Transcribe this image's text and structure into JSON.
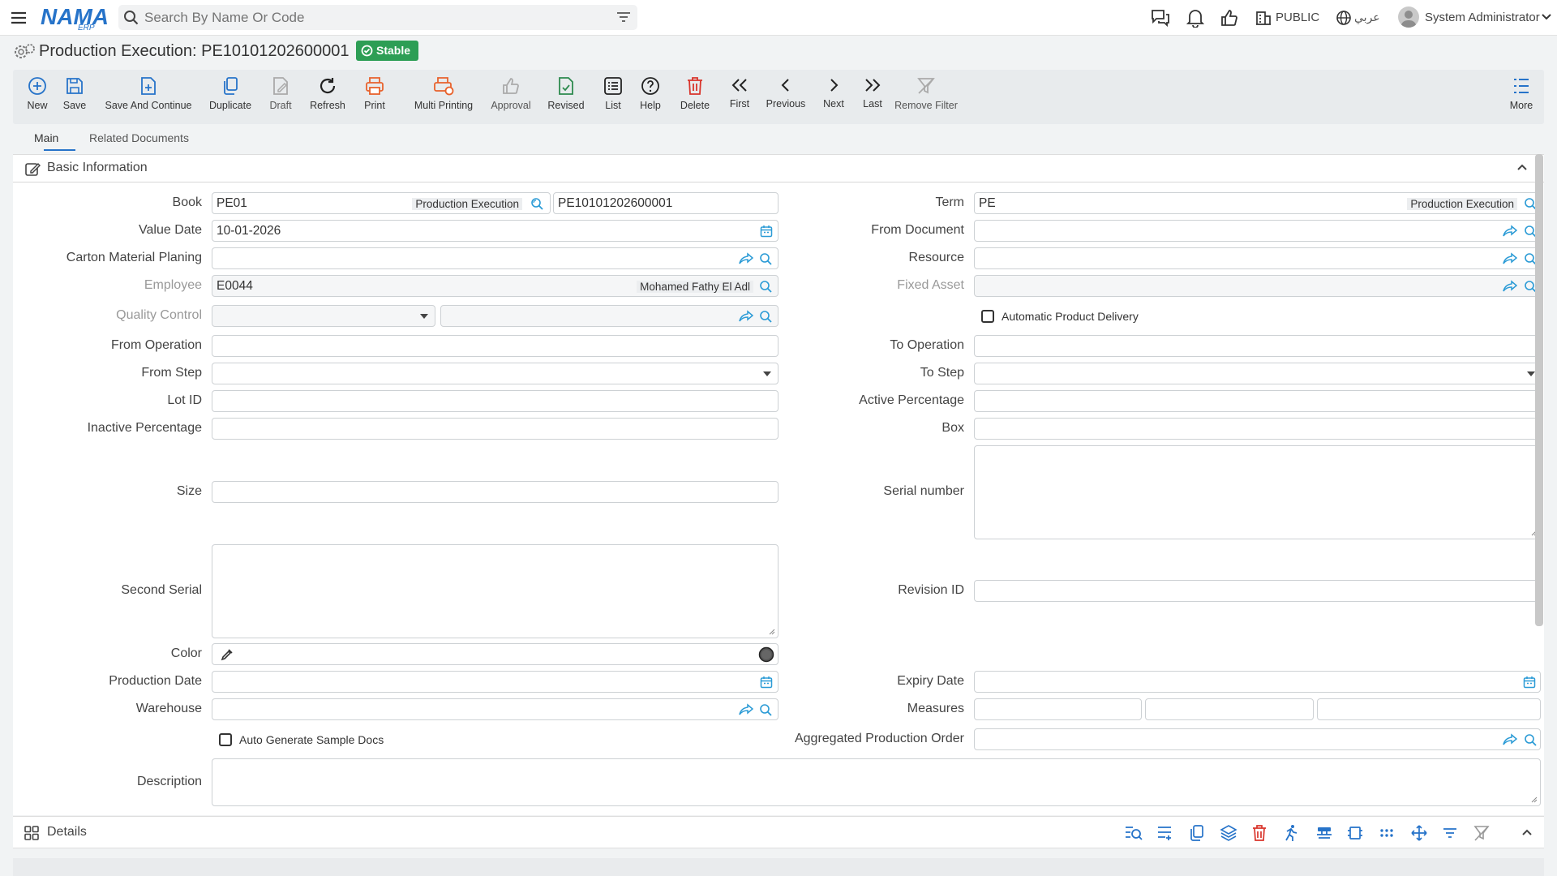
{
  "app": {
    "logo": "NAMA",
    "logo_sub": "ERP"
  },
  "search": {
    "placeholder": "Search By Name Or Code"
  },
  "topbar": {
    "public_label": "PUBLIC",
    "language_label": "عربي",
    "user_name": "System Administrator"
  },
  "page": {
    "title": "Production Execution: PE10101202600001",
    "status": "Stable"
  },
  "toolbar": {
    "new": "New",
    "save": "Save",
    "save_continue": "Save And Continue",
    "duplicate": "Duplicate",
    "draft": "Draft",
    "refresh": "Refresh",
    "print": "Print",
    "multi_print": "Multi Printing",
    "approval": "Approval",
    "revised": "Revised",
    "list": "List",
    "help": "Help",
    "delete": "Delete",
    "first": "First",
    "previous": "Previous",
    "next": "Next",
    "last": "Last",
    "remove_filter": "Remove Filter",
    "more": "More"
  },
  "tabs": [
    "Main",
    "Related Documents"
  ],
  "section": {
    "title": "Basic Information"
  },
  "form": {
    "book": {
      "label": "Book",
      "value": "PE01",
      "name": "Production Execution",
      "code": "PE10101202600001"
    },
    "term": {
      "label": "Term",
      "value": "PE",
      "name": "Production Execution"
    },
    "value_date": {
      "label": "Value Date",
      "value": "10-01-2026"
    },
    "from_document": {
      "label": "From Document"
    },
    "carton": {
      "label": "Carton Material Planing"
    },
    "resource": {
      "label": "Resource"
    },
    "employee": {
      "label": "Employee",
      "value": "E0044",
      "name": "Mohamed Fathy El Adl"
    },
    "fixed_asset": {
      "label": "Fixed Asset"
    },
    "quality_control": {
      "label": "Quality Control"
    },
    "auto_product_delivery": {
      "label": "Automatic Product Delivery"
    },
    "from_operation": {
      "label": "From Operation"
    },
    "to_operation": {
      "label": "To Operation"
    },
    "from_step": {
      "label": "From Step"
    },
    "to_step": {
      "label": "To Step"
    },
    "lot_id": {
      "label": "Lot ID"
    },
    "active_percentage": {
      "label": "Active Percentage"
    },
    "inactive_percentage": {
      "label": "Inactive Percentage"
    },
    "box": {
      "label": "Box"
    },
    "size": {
      "label": "Size"
    },
    "serial_number": {
      "label": "Serial number"
    },
    "second_serial": {
      "label": "Second Serial"
    },
    "revision_id": {
      "label": "Revision ID"
    },
    "color": {
      "label": "Color"
    },
    "production_date": {
      "label": "Production Date"
    },
    "expiry_date": {
      "label": "Expiry Date"
    },
    "warehouse": {
      "label": "Warehouse"
    },
    "measures": {
      "label": "Measures"
    },
    "auto_sample_docs": {
      "label": "Auto Generate Sample Docs"
    },
    "aggregated_order": {
      "label": "Aggregated Production Order"
    },
    "description": {
      "label": "Description"
    }
  },
  "details": {
    "title": "Details"
  },
  "colors": {
    "accent": "#2673c9",
    "success": "#2d9e55",
    "danger": "#d9342b",
    "print": "#e8622c",
    "green": "#2d8a4e"
  }
}
